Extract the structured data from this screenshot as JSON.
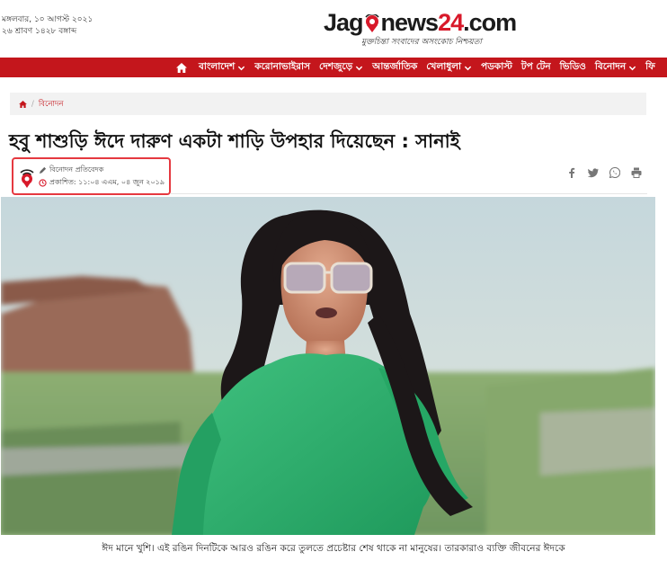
{
  "header": {
    "date_line1": "মঙ্গলবার, ১০ আগস্ট ২০২১",
    "date_line2": "২৬ শ্রাবণ ১৪২৮ বঙ্গাব্দ",
    "logo_part1": "Jag",
    "logo_part2": "news",
    "logo_part3": "24",
    "logo_part4": ".com",
    "logo_tagline": "মুক্তচিন্তা সংবাদের অসংকোচ নিশ্চয়তা",
    "brand_color": "#c4161c"
  },
  "nav": {
    "home_icon": "home-icon",
    "items": [
      {
        "label": "বাংলাদেশ",
        "dropdown": true
      },
      {
        "label": "করোনাভাইরাস",
        "dropdown": false
      },
      {
        "label": "দেশজুড়ে",
        "dropdown": true
      },
      {
        "label": "আন্তর্জাতিক",
        "dropdown": false
      },
      {
        "label": "খেলাধুলা",
        "dropdown": true
      },
      {
        "label": "পডকাস্ট",
        "dropdown": false
      },
      {
        "label": "টপ টেন",
        "dropdown": false
      },
      {
        "label": "ভিডিও",
        "dropdown": false
      },
      {
        "label": "বিনোদন",
        "dropdown": true
      },
      {
        "label": "ফি",
        "dropdown": false
      }
    ]
  },
  "breadcrumb": {
    "home_icon": "home-icon",
    "separator": "/",
    "current": "বিনোদন"
  },
  "article": {
    "title": "হবু শাশুড়ি ঈদে দারুণ একটা শাড়ি উপহার দিয়েছেন : সানাই",
    "author": "বিনোদন প্রতিবেদক",
    "published": "প্রকাশিত: ১১:০৪ এএম, ০৪ জুন ২০১৯",
    "caption": "ঈদ মানে খুশি। এই রঙিন দিনটিকে আরও রঙিন করে তুলতে প্রচেষ্টার শেষ থাকে না মানুষের। তারকারাও ব্যক্তি জীবনের ঈদকে"
  },
  "share": {
    "icons": [
      "facebook-icon",
      "twitter-icon",
      "whatsapp-icon",
      "print-icon"
    ]
  },
  "colors": {
    "nav_bg": "#c4161c",
    "highlight_border": "#e53940",
    "breadcrumb_bg": "#f2f2f2"
  }
}
